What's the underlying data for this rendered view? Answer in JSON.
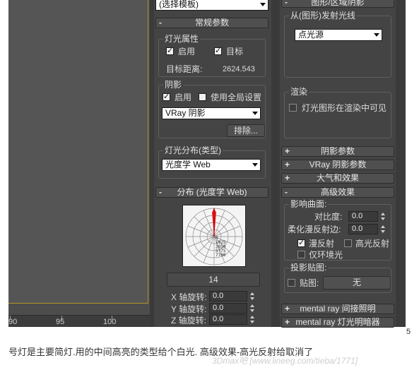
{
  "viewport": {
    "timeline_ticks": [
      "90",
      "95",
      "100"
    ]
  },
  "col1": {
    "top_dropdown": "(选择模板)",
    "general": {
      "header": "常规参数",
      "light_props_title": "灯光属性",
      "enable_label": "启用",
      "target_label": "目标",
      "target_dist_label": "目标距离:",
      "target_dist_value": "2624.543",
      "shadow_title": "阴影",
      "shadow_enable_label": "启用",
      "global_label": "使用全局设置",
      "shadow_type": "VRay 阴影",
      "exclude_btn": "排除...",
      "distribution_title": "灯光分布(类型)",
      "distribution_type": "光度学 Web"
    },
    "distribution": {
      "header": "分布 (光度学 Web)",
      "web_labels": [
        "0",
        "1925",
        "3850",
        "5775",
        "7700"
      ],
      "file_value": "14",
      "x_label": "X 轴旋转:",
      "x_value": "0.0",
      "y_label": "Y 轴旋转:",
      "y_value": "0.0",
      "z_label": "Z 轴旋转:",
      "z_value": "0.0"
    }
  },
  "col2": {
    "top_header": "图形/区域阴影",
    "emit_title": "从(图形)发射光线",
    "emit_type": "点光源",
    "render_title": "渲染",
    "render_check_label": "灯光图形在渲染中可见",
    "rollouts": [
      "阴影参数",
      "VRay 阴影参数",
      "大气和效果"
    ],
    "advanced": {
      "header": "高级效果",
      "affect_title": "影响曲面:",
      "contrast_label": "对比度:",
      "contrast_value": "0.0",
      "soften_label": "柔化漫反射边:",
      "soften_value": "0.0",
      "diffuse_label": "漫反射",
      "specular_label": "高光反射",
      "ambient_label": "仅环境光",
      "proj_title": "投影贴图:",
      "map_label": "贴图:",
      "map_value": "无"
    },
    "bottom_rollouts": [
      "mental ray 间接照明",
      "mental ray 灯光明暗器"
    ]
  },
  "edge_number": "5",
  "caption": "号灯是主要简灯.用的中间高亮的类型给个白光. 高级效果-高光反射给取消了",
  "watermark": "3Dmax吧   [www.lineeg.com/tieba/1771]"
}
